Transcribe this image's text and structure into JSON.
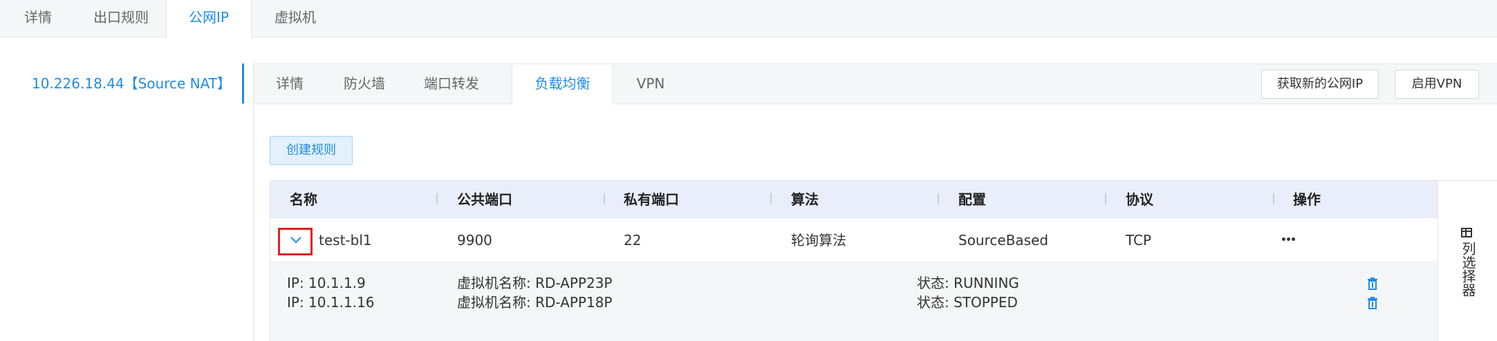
{
  "top_tabs": [
    {
      "label": "详情"
    },
    {
      "label": "出口规则"
    },
    {
      "label": "公网IP"
    },
    {
      "label": "虚拟机"
    }
  ],
  "ip_list": [
    {
      "label": "10.226.18.44【Source NAT】"
    }
  ],
  "sub_tabs": [
    {
      "label": "详情"
    },
    {
      "label": "防火墙"
    },
    {
      "label": "端口转发"
    },
    {
      "label": "负载均衡"
    },
    {
      "label": "VPN"
    }
  ],
  "header_buttons": {
    "acquire_ip": "获取新的公网IP",
    "enable_vpn": "启用VPN"
  },
  "create_rule_label": "创建规则",
  "table": {
    "columns": [
      "名称",
      "公共端口",
      "私有端口",
      "算法",
      "配置",
      "协议",
      "操作"
    ],
    "rows": [
      {
        "name": "test-bl1",
        "public_port": "9900",
        "private_port": "22",
        "algorithm": "轮询算法",
        "config": "SourceBased",
        "protocol": "TCP",
        "members": [
          {
            "ip": "IP: 10.1.1.9",
            "vm": "虚拟机名称: RD-APP23P",
            "status": "状态: RUNNING"
          },
          {
            "ip": "IP: 10.1.1.16",
            "vm": "虚拟机名称: RD-APP18P",
            "status": "状态: STOPPED"
          }
        ]
      }
    ]
  },
  "column_chooser_label": "列选择器",
  "colors": {
    "accent": "#1f8ce8",
    "highlight_border": "#e02020",
    "header_bg": "#eaeefa"
  }
}
